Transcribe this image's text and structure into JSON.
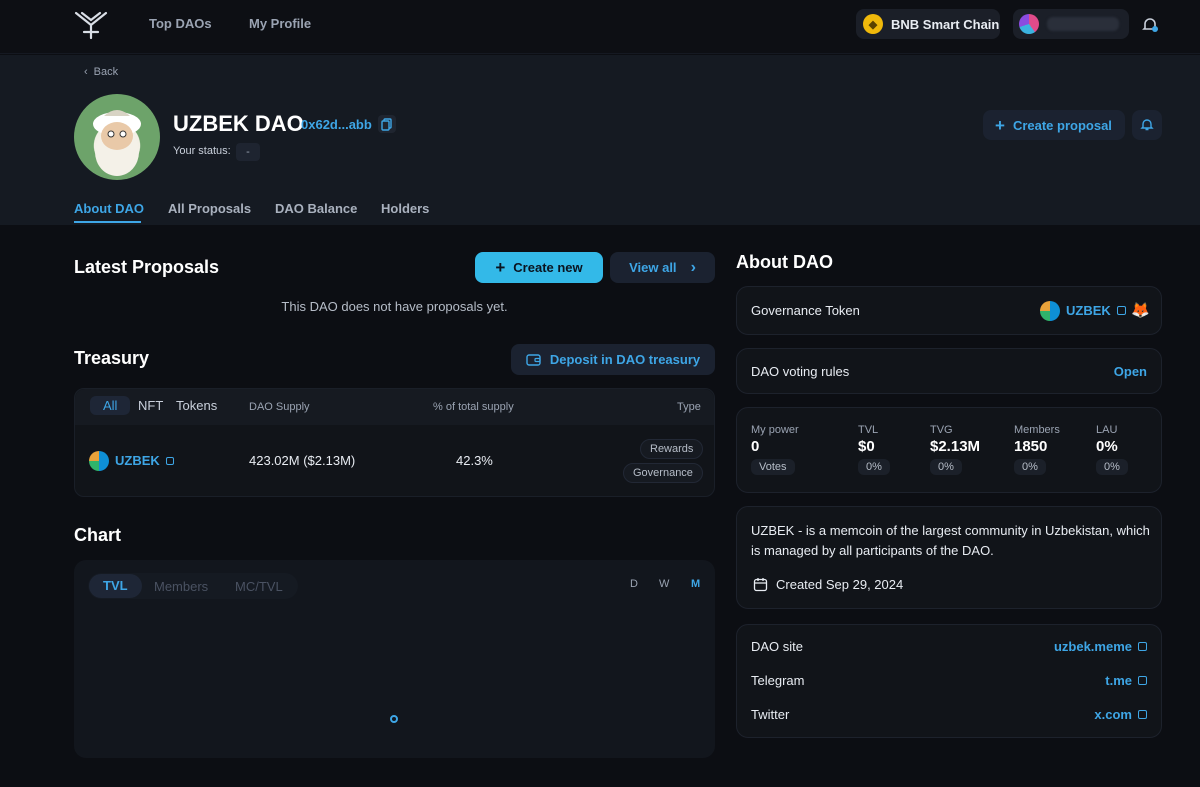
{
  "nav": {
    "top_daos": "Top DAOs",
    "my_profile": "My Profile",
    "chain": "BNB Smart Chain"
  },
  "header": {
    "back": "Back",
    "dao_name": "UZBEK DAO",
    "address": "0x62d...abb",
    "status_label": "Your status:",
    "status_value": "-",
    "create_proposal": "Create proposal"
  },
  "tabs": [
    {
      "label": "About DAO"
    },
    {
      "label": "All Proposals"
    },
    {
      "label": "DAO Balance"
    },
    {
      "label": "Holders"
    }
  ],
  "proposals": {
    "title": "Latest Proposals",
    "create_new": "Create new",
    "view_all": "View all",
    "empty": "This DAO does not have proposals yet."
  },
  "treasury": {
    "title": "Treasury",
    "deposit": "Deposit in DAO treasury",
    "filters": [
      "All",
      "NFT",
      "Tokens"
    ],
    "columns": {
      "supply": "DAO Supply",
      "percent": "% of total supply",
      "type": "Type"
    },
    "rows": [
      {
        "token": "UZBEK",
        "supply": "423.02M ($2.13M)",
        "percent": "42.3%",
        "types": [
          "Rewards",
          "Governance"
        ]
      }
    ]
  },
  "chart": {
    "title": "Chart",
    "tabs": [
      "TVL",
      "Members",
      "MC/TVL"
    ],
    "ranges": [
      "D",
      "W",
      "M"
    ]
  },
  "about": {
    "title": "About DAO",
    "governance_label": "Governance Token",
    "governance_token": "UZBEK",
    "voting_label": "DAO voting rules",
    "voting_value": "Open",
    "stats": [
      {
        "label": "My power",
        "value": "0",
        "badge": "Votes"
      },
      {
        "label": "TVL",
        "value": "$0",
        "badge": "0%"
      },
      {
        "label": "TVG",
        "value": "$2.13M",
        "badge": "0%"
      },
      {
        "label": "Members",
        "value": "1850",
        "badge": "0%"
      },
      {
        "label": "LAU",
        "value": "0%",
        "badge": "0%"
      }
    ],
    "description": "UZBEK -  is a memcoin of the largest community in Uzbekistan, which is managed by all participants of the DAO.",
    "created": "Created Sep 29, 2024",
    "links": [
      {
        "label": "DAO site",
        "value": "uzbek.meme"
      },
      {
        "label": "Telegram",
        "value": "t.me"
      },
      {
        "label": "Twitter",
        "value": "x.com"
      }
    ]
  },
  "colors": {
    "accent": "#3ea6e6",
    "primary_button": "#33b9e8",
    "background": "#0c0e13",
    "card": "#111419"
  }
}
